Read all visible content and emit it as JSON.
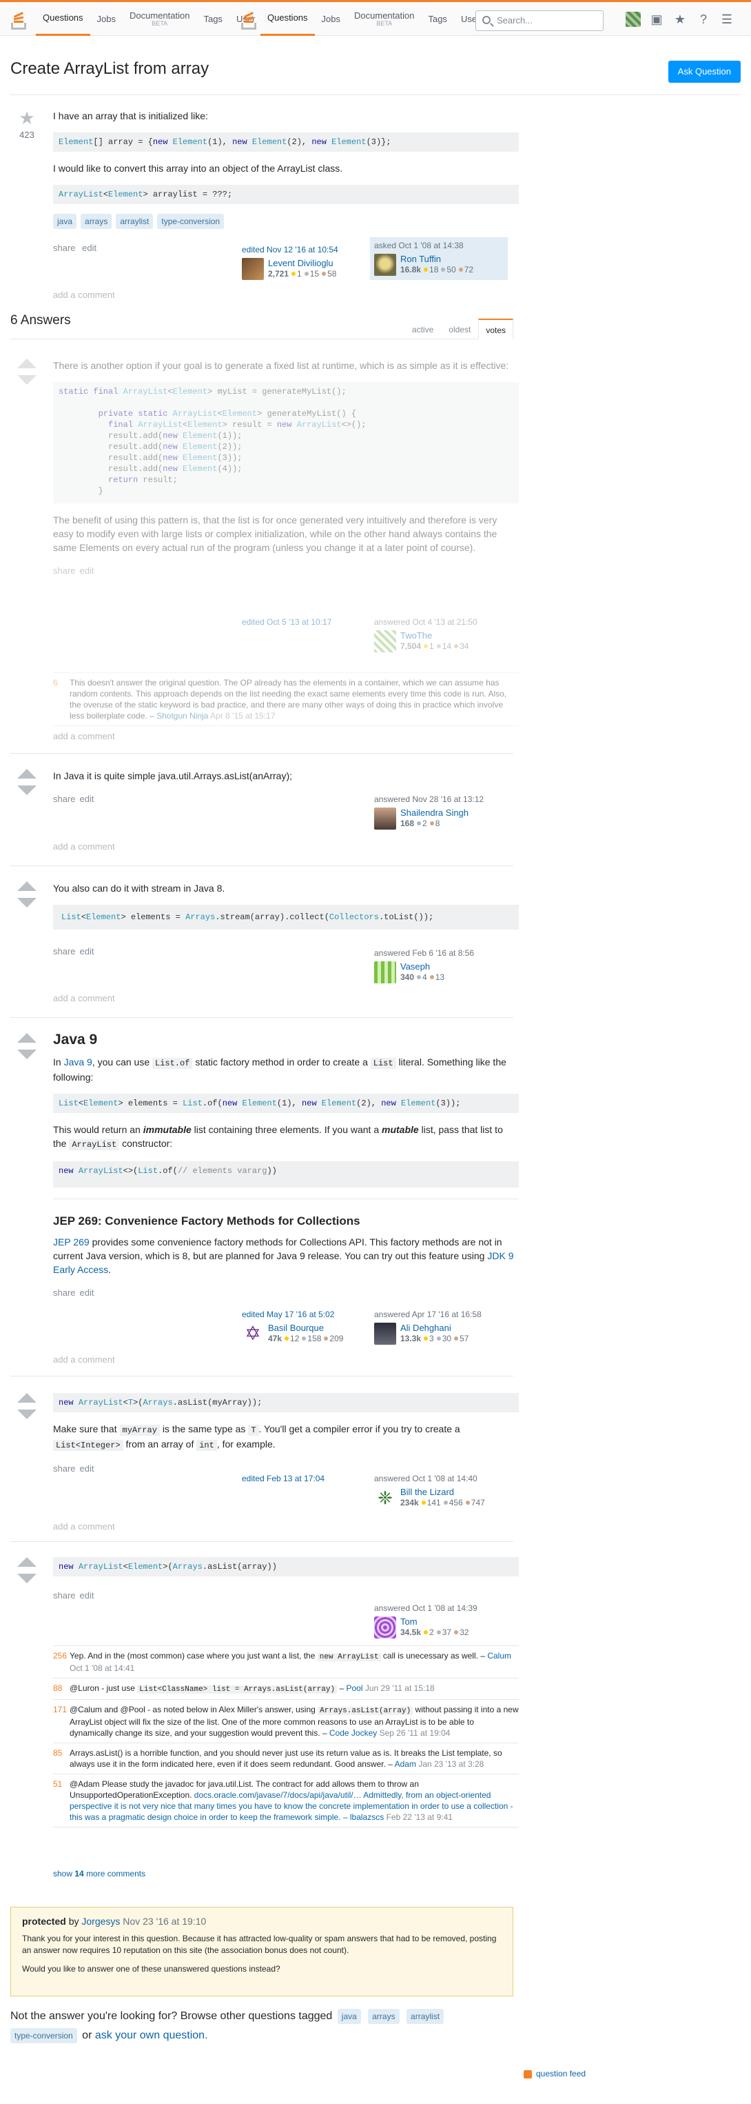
{
  "nav": {
    "links_left": [
      "Questions",
      "Jobs",
      "Documentation",
      "Tags",
      "User"
    ],
    "links_right": [
      "Questions",
      "Jobs",
      "Documentation",
      "Tags",
      "Users"
    ],
    "beta": "BETA",
    "search_placeholder": "Search..."
  },
  "question": {
    "title": "Create ArrayList from array",
    "ask_button": "Ask Question",
    "votes": "423",
    "body_p1": "I have an array that is initialized like:",
    "body_p2": "I would like to convert this array into an object of the ArrayList class.",
    "tags": [
      "java",
      "arrays",
      "arraylist",
      "type-conversion"
    ],
    "menu": [
      "share",
      "edit"
    ],
    "edited": {
      "when": "edited Nov 12 '16 at 10:54",
      "user": "Levent Divilioglu",
      "rep": "2,721",
      "gold": "1",
      "silver": "15",
      "bronze": "58"
    },
    "asked": {
      "when": "asked Oct 1 '08 at 14:38",
      "user": "Ron Tuffin",
      "rep": "16.8k",
      "gold": "18",
      "silver": "50",
      "bronze": "72"
    },
    "add_comment": "add a comment"
  },
  "answers_header": {
    "count": "6 Answers",
    "tabs": [
      "active",
      "oldest",
      "votes"
    ]
  },
  "answers": [
    {
      "p1": "There is another option if your goal is to generate a fixed list at runtime, which is as simple as it is effective:",
      "p2": "The benefit of using this pattern is, that the list is for once generated very intuitively and therefore is very easy to modify even with large lists or complex initialization, while on the other hand always contains the same Elements on every actual run of the program (unless you change it at a later point of course).",
      "edited": "edited Oct 5 '13 at 10:17",
      "answered": "answered Oct 4 '13 at 21:50",
      "user": "TwoThe",
      "rep": "7,504",
      "gold": "1",
      "silver": "14",
      "bronze": "34",
      "comment_score": "6",
      "comment_text": "This doesn't answer the original question. The OP already has the elements in a container, which we can assume has random contents. This approach depends on the list needing the exact same elements every time this code is run. Also, the overuse of the static keyword is bad practice, and there are many other ways of doing this in practice which involve less boilerplate code. –",
      "comment_user": "Shotgun Ninja",
      "comment_date": "Apr 8 '15 at 15:17"
    },
    {
      "p1": "In Java it is quite simple java.util.Arrays.asList(anArray);",
      "answered": "answered Nov 28 '16 at 13:12",
      "user": "Shailendra Singh",
      "rep": "168",
      "silver": "2",
      "bronze": "8"
    },
    {
      "p1": "You also can do it with stream in Java 8.",
      "answered": "answered Feb 6 '16 at 8:56",
      "user": "Vaseph",
      "rep": "340",
      "silver": "4",
      "bronze": "13"
    },
    {
      "h1": "Java 9",
      "p1a": "In",
      "link1": "Java 9",
      "p1b": ", you can use",
      "code1": "List.of",
      "p1c": "static factory method in order to create a",
      "code2": "List",
      "p1d": "literal. Something like the following:",
      "p2a": "This would return an",
      "em1": "immutable",
      "p2b": "list containing three elements. If you want a",
      "em2": "mutable",
      "p2c": "list, pass that list to the",
      "code3": "ArrayList",
      "p2d": "constructor:",
      "h2": "JEP 269: Convenience Factory Methods for Collections",
      "link2": "JEP 269",
      "p3a": "provides some convenience factory methods for Collections API. This factory methods are not in current Java version, which is 8, but are planned for Java 9 release. You can try out this feature using",
      "link3": "JDK 9 Early Access",
      "p3b": ".",
      "edited": "edited May 17 '16 at 5:02",
      "edited_user": "Basil Bourque",
      "edited_rep": "47k",
      "edited_gold": "12",
      "edited_silver": "158",
      "edited_bronze": "209",
      "answered": "answered Apr 17 '16 at 16:58",
      "user": "Ali Dehghani",
      "rep": "13.3k",
      "gold": "3",
      "silver": "30",
      "bronze": "57"
    },
    {
      "p1a": "Make sure that",
      "code1": "myArray",
      "p1b": "is the same type as",
      "code2": "T",
      "p1c": ". You'll get a compiler error if you try to create a",
      "code3": "List<Integer>",
      "p1d": "from an array of",
      "code4": "int",
      "p1e": ", for example.",
      "edited": "edited Feb 13 at 17:04",
      "answered": "answered Oct 1 '08 at 14:40",
      "user": "Bill the Lizard",
      "rep": "234k",
      "gold": "141",
      "silver": "456",
      "bronze": "747"
    },
    {
      "answered": "answered Oct 1 '08 at 14:39",
      "user": "Tom",
      "rep": "34.5k",
      "gold": "2",
      "silver": "37",
      "bronze": "32"
    }
  ],
  "comments_last": [
    {
      "score": "256",
      "text_a": "Yep. And in the (most common) case where you just want a list, the",
      "code": "new ArrayList",
      "text_b": "call is unecessary as well. –",
      "user": "Calum",
      "date": "Oct 1 '08 at 14:41"
    },
    {
      "score": "88",
      "text_a": "@Luron - just use",
      "code": "List<ClassName> list = Arrays.asList(array)",
      "text_b": "–",
      "user": "Pool",
      "date": "Jun 29 '11 at 15:18"
    },
    {
      "score": "171",
      "text_a": "@Calum and @Pool - as noted below in Alex Miller's answer, using",
      "code": "Arrays.asList(array)",
      "text_b": "without passing it into a new ArrayList object will fix the size of the list. One of the more common reasons to use an ArrayList is to be able to dynamically change its size, and your suggestion would prevent this. –",
      "user": "Code Jockey",
      "date": "Sep 26 '11 at 19:04"
    },
    {
      "score": "85",
      "text_a": "Arrays.asList() is a horrible function, and you should never just use its return value as is. It breaks the List template, so always use it in the form indicated here, even if it does seem redundant. Good answer. –",
      "code": "",
      "text_b": "",
      "user": "Adam",
      "date": "Jan 23 '13 at 3:28"
    },
    {
      "score": "51",
      "text_a": "@Adam Please study the javadoc for java.util.List. The contract for add allows them to throw an UnsupportedOperationException.",
      "code": "",
      "text_b": "docs.oracle.com/javase/7/docs/api/java/util/… Admittedly, from an object-oriented perspective it is not very nice that many times you have to know the concrete implementation in order to use a collection - this was a pragmatic design choice in order to keep the framework simple. –",
      "user": "lbalazscs",
      "date": "Feb 22 '13 at 9:41"
    }
  ],
  "show_more": {
    "a": "show",
    "n": "14",
    "b": "more comments"
  },
  "protected": {
    "title_a": "protected",
    "by": "by",
    "user": "Jorgesys",
    "date": "Nov 23 '16 at 19:10",
    "p1": "Thank you for your interest in this question. Because it has attracted low-quality or spam answers that had to be removed, posting an answer now requires 10 reputation on this site (the association bonus does not count).",
    "p2": "Would you like to answer one of these unanswered questions instead?"
  },
  "footer": {
    "text": "Not the answer you're looking for? Browse other questions tagged",
    "tags": [
      "java",
      "arrays",
      "arraylist",
      "type-conversion"
    ],
    "or": "or",
    "ask_link": "ask your own question.",
    "feed": "question feed"
  },
  "colors": {
    "accent": "#f48024",
    "link": "#0c65a5",
    "button": "#0095ff",
    "tag_bg": "#e1ecf4"
  }
}
